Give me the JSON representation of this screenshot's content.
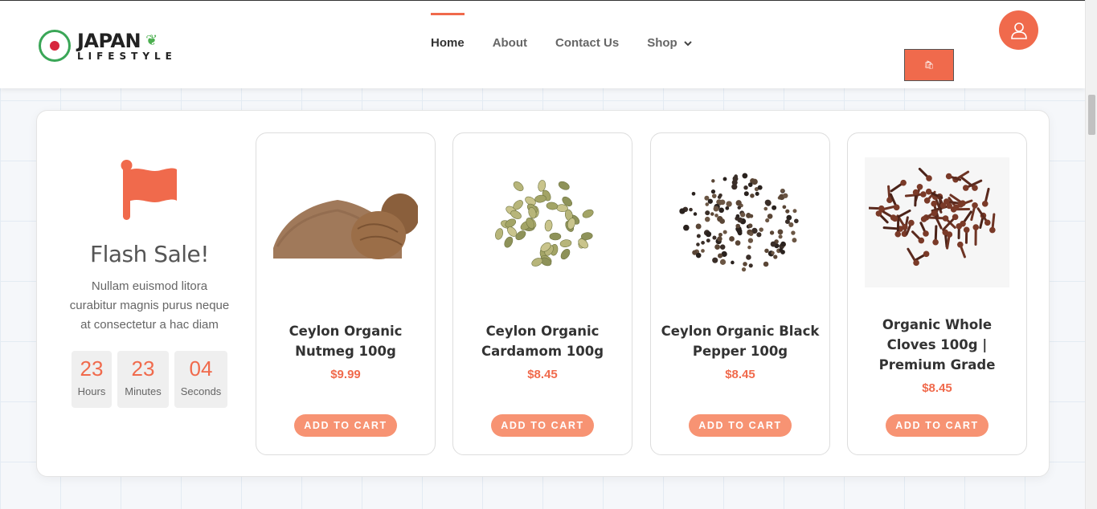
{
  "brand": {
    "name_top": "JAPAN",
    "name_bottom": "LIFESTYLE",
    "logo_badge_text": "JAPAN LIFESTYLE"
  },
  "nav": {
    "items": [
      {
        "label": "Home"
      },
      {
        "label": "About"
      },
      {
        "label": "Contact Us"
      },
      {
        "label": "Shop"
      }
    ],
    "active_index": 0
  },
  "colors": {
    "accent": "#f06a4c",
    "button": "#f79373"
  },
  "flash_sale": {
    "title": "Flash Sale!",
    "description": "Nullam euismod litora curabitur magnis purus neque at consectetur a hac diam",
    "countdown": [
      {
        "value": "23",
        "label": "Hours"
      },
      {
        "value": "23",
        "label": "Minutes"
      },
      {
        "value": "04",
        "label": "Seconds"
      }
    ]
  },
  "products": [
    {
      "title": "Ceylon Organic Nutmeg 100g",
      "price": "$9.99",
      "button": "ADD TO CART",
      "image": "nutmeg"
    },
    {
      "title": "Ceylon Organic Cardamom 100g",
      "price": "$8.45",
      "button": "ADD TO CART",
      "image": "cardamom"
    },
    {
      "title": "Ceylon Organic Black Pepper 100g",
      "price": "$8.45",
      "button": "ADD TO CART",
      "image": "black-pepper"
    },
    {
      "title": "Organic Whole Cloves 100g | Premium Grade",
      "price": "$8.45",
      "button": "ADD TO CART",
      "image": "cloves"
    }
  ]
}
